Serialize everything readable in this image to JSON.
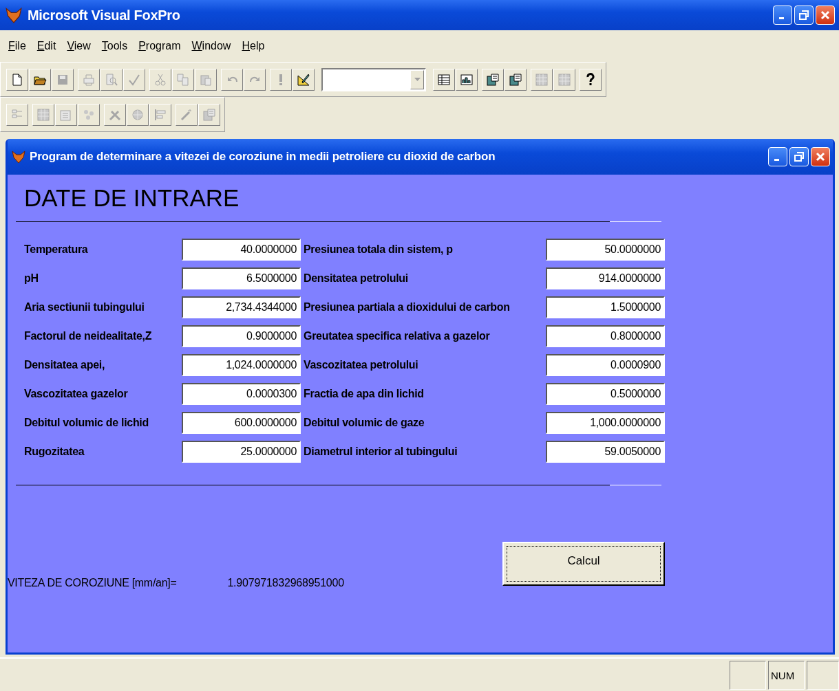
{
  "window": {
    "title": "Microsoft Visual FoxPro"
  },
  "menu": [
    "File",
    "Edit",
    "View",
    "Tools",
    "Program",
    "Window",
    "Help"
  ],
  "toolbar_1": {
    "groups_before_combo": [
      [
        {
          "disabled": false
        },
        {
          "disabled": false
        },
        {
          "disabled": true
        }
      ],
      [
        {
          "disabled": true
        },
        {
          "disabled": true
        },
        {
          "disabled": true
        }
      ],
      [
        {
          "disabled": true
        },
        {
          "disabled": true
        },
        {
          "disabled": true
        }
      ],
      [
        {
          "disabled": true
        },
        {
          "disabled": true
        }
      ],
      [
        {
          "disabled": true
        },
        {
          "disabled": false
        }
      ]
    ],
    "groups_after_combo": [
      [
        {
          "disabled": false
        },
        {
          "disabled": false
        }
      ],
      [
        {
          "disabled": false
        },
        {
          "disabled": false
        }
      ],
      [
        {
          "disabled": true
        },
        {
          "disabled": true
        }
      ],
      [
        {
          "disabled": false
        }
      ]
    ]
  },
  "toolbar_2": {
    "groups": [
      [
        {
          "disabled": true
        }
      ],
      [
        {
          "disabled": true
        },
        {
          "disabled": true
        },
        {
          "disabled": true
        }
      ],
      [
        {
          "disabled": true
        },
        {
          "disabled": true
        },
        {
          "disabled": true
        }
      ],
      [
        {
          "disabled": true
        },
        {
          "disabled": true
        }
      ]
    ]
  },
  "form_window": {
    "title": "Program de determinare a vitezei de coroziune in medii petroliere cu dioxid de carbon",
    "heading": "DATE DE INTRARE",
    "rows": [
      {
        "left": {
          "label": "Temperatura",
          "value": "40.0000000"
        },
        "right": {
          "label": "Presiunea totala din sistem, p",
          "value": "50.0000000"
        }
      },
      {
        "left": {
          "label": "pH",
          "value": "6.5000000"
        },
        "right": {
          "label": "Densitatea petrolului",
          "value": "914.0000000"
        }
      },
      {
        "left": {
          "label": "Aria  sectiunii tubingului",
          "value": "2,734.4344000"
        },
        "right": {
          "label": "Presiunea partiala a dioxidului de carbon",
          "value": "1.5000000"
        }
      },
      {
        "left": {
          "label": "Factorul de neidealitate,Z",
          "value": "0.9000000"
        },
        "right": {
          "label": "Greutatea specifica relativa a gazelor",
          "value": "0.8000000"
        }
      },
      {
        "left": {
          "label": "Densitatea apei,",
          "value": "1,024.0000000"
        },
        "right": {
          "label": "Vascozitatea petrolului",
          "value": "0.0000900"
        }
      },
      {
        "left": {
          "label": "Vascozitatea gazelor",
          "value": "0.0000300"
        },
        "right": {
          "label": "Fractia de apa din lichid",
          "value": "0.5000000"
        }
      },
      {
        "left": {
          "label": "Debitul volumic de lichid",
          "value": "600.0000000"
        },
        "right": {
          "label": "Debitul volumic de gaze",
          "value": "1,000.0000000"
        }
      },
      {
        "left": {
          "label": "Rugozitatea",
          "value": "25.0000000"
        },
        "right": {
          "label": "Diametrul  interior al tubingului",
          "value": "59.0050000"
        }
      }
    ],
    "result": {
      "label": "VITEZA DE COROZIUNE [mm/an]=",
      "value": "1.907971832968951000"
    },
    "calc_button": "Calcul"
  },
  "status_bar": {
    "indicator": "NUM"
  }
}
